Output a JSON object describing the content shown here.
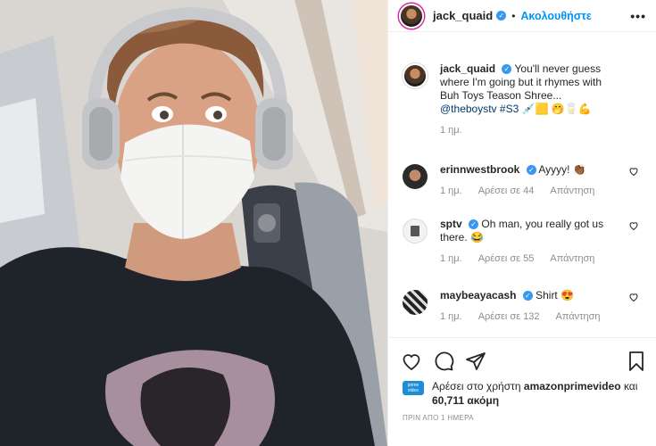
{
  "header": {
    "username": "jack_quaid",
    "follow_label": "Ακολουθήστε",
    "more_label": "•••",
    "dot": "•"
  },
  "caption": {
    "username": "jack_quaid",
    "text": "You'll never guess where I'm going but it rhymes with Buh Toys Teason Shree...",
    "mention": "@theboystv",
    "hashtag": "#S3",
    "emojis": "💉🟨 🤭🥛💪",
    "time": "1 ημ."
  },
  "comments": [
    {
      "username": "erinnwestbrook",
      "text": "Ayyyy! 👏🏾",
      "time": "1 ημ.",
      "likes": "Αρέσει σε 44",
      "reply": "Απάντηση"
    },
    {
      "username": "sptv",
      "text": "Oh man, you really got us there. 😂",
      "time": "1 ημ.",
      "likes": "Αρέσει σε 55",
      "reply": "Απάντηση"
    },
    {
      "username": "maybeayacash",
      "text": "Shirt 😍",
      "time": "1 ημ.",
      "likes": "Αρέσει σε 132",
      "reply": "Απάντηση"
    }
  ],
  "likes": {
    "prefix": "Αρέσει στο χρήστη",
    "user": "amazonprimevideo",
    "connector": "και",
    "count": "60,711 ακόμη",
    "badge": "prime video"
  },
  "posted_ago": "ΠΡΙΝ ΑΠΟ 1 ΗΜΕΡΑ",
  "icons": [
    "heart-icon",
    "comment-icon",
    "share-icon",
    "bookmark-icon",
    "verified-icon",
    "more-icon"
  ],
  "colors": {
    "link": "#0095f6",
    "verified": "#3897f0",
    "muted": "#8e8e8e",
    "text": "#262626"
  }
}
